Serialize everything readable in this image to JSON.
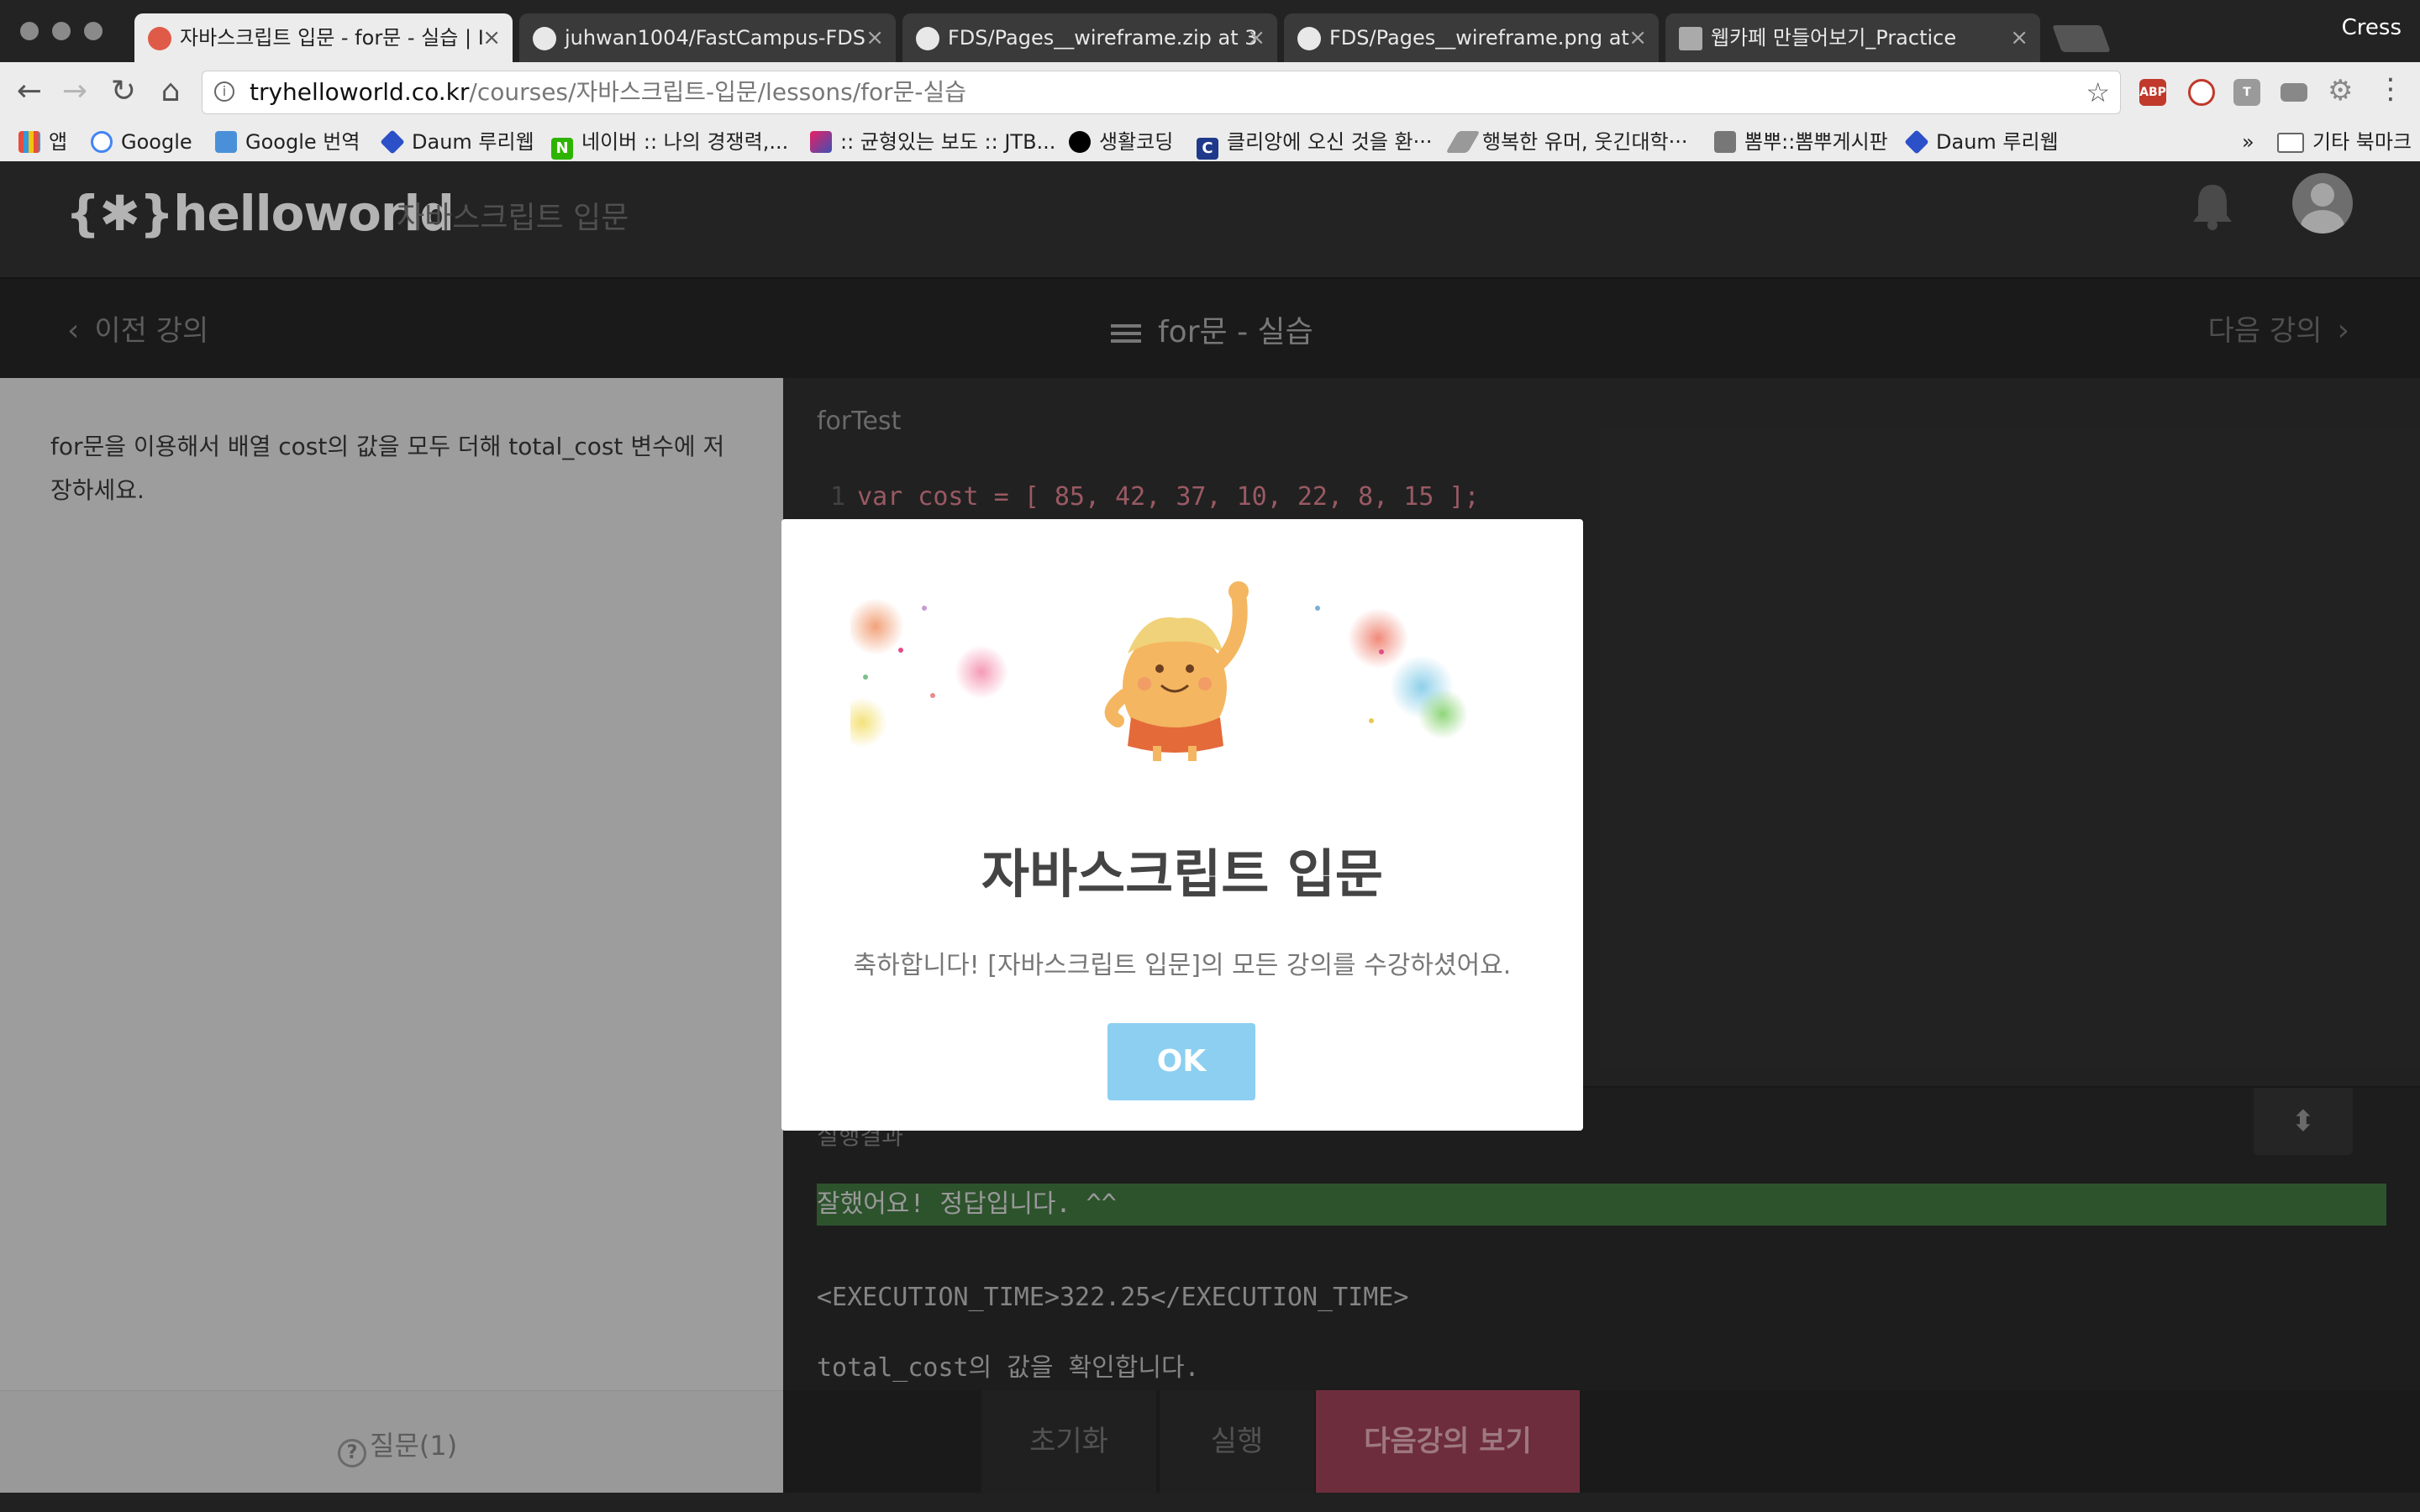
{
  "browser": {
    "tabs": [
      {
        "label": "자바스크립트 입문 - for문 - 실습 | I"
      },
      {
        "label": "juhwan1004/FastCampus-FDS"
      },
      {
        "label": "FDS/Pages__wireframe.zip at 3"
      },
      {
        "label": "FDS/Pages__wireframe.png at"
      },
      {
        "label": "웹카페 만들어보기_Practice"
      }
    ],
    "profile_name": "Cress",
    "url_host": "tryhelloworld.co.kr",
    "url_path": "/courses/자바스크립트-입문/lessons/for문-실습",
    "extensions": [
      "ABP",
      "T"
    ],
    "bookmarks": [
      {
        "label": "앱"
      },
      {
        "label": "Google"
      },
      {
        "label": "Google 번역"
      },
      {
        "label": "Daum 루리웹"
      },
      {
        "label": "네이버 :: 나의 경쟁력,..."
      },
      {
        "label": ":: 균형있는 보도 :: JTB..."
      },
      {
        "label": "생활코딩"
      },
      {
        "label": "클리앙에 오신 것을 환···"
      },
      {
        "label": "행복한 유머, 웃긴대학···"
      },
      {
        "label": "뽐뿌::뽐뿌게시판"
      },
      {
        "label": "Daum 루리웹"
      }
    ],
    "bookmarks_overflow": "»",
    "other_bookmarks": "기타 북마크"
  },
  "app": {
    "logo": "{✱}helloworld",
    "course": "자바스크립트 입문"
  },
  "lesson_nav": {
    "prev": "이전 강의",
    "title": "for문 - 실습",
    "next": "다음 강의"
  },
  "left_pane": {
    "instruction": "for문을 이용해서 배열 cost의 값을 모두 더해 total_cost 변수에 저장하세요.",
    "question": "질문(1)"
  },
  "editor": {
    "filename": "forTest",
    "line_number": "1",
    "code": "var cost = [ 85, 42, 37, 10, 22, 8, 15 ];"
  },
  "output": {
    "label": "실행결과",
    "success": "잘했어요! 정답입니다. ^^",
    "lines": [
      "<EXECUTION_TIME>322.25</EXECUTION_TIME>",
      "total_cost의 값을 확인합니다."
    ]
  },
  "actions": {
    "reset": "초기화",
    "run": "실행",
    "next_lesson": "다음강의 보기"
  },
  "modal": {
    "title": "자바스크립트 입문",
    "message": "축하합니다! [자바스크립트 입문]의 모든 강의를 수강하셨어요.",
    "ok": "OK"
  },
  "colors": {
    "accent_pink": "#8e3a4e",
    "ok_blue": "#8ccff0",
    "success_green": "#3a6b3a"
  }
}
